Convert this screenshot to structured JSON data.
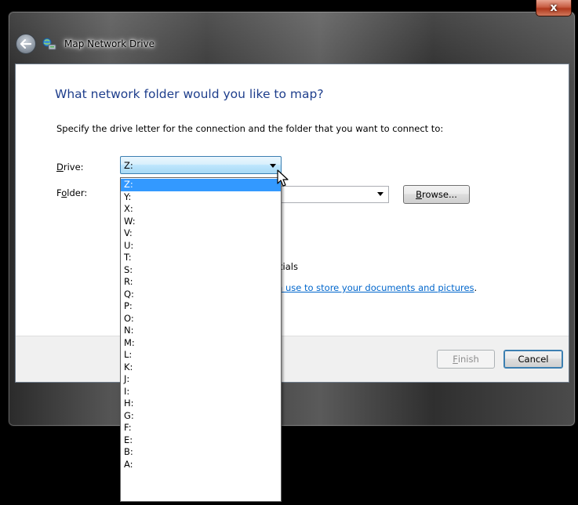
{
  "window": {
    "title": "Map Network Drive",
    "close_glyph": "x"
  },
  "main": {
    "heading": "What network folder would you like to map?",
    "instruction": "Specify the drive letter for the connection and the folder that you want to connect to:",
    "drive_label_accel": "D",
    "drive_label_rest": "rive:",
    "folder_label_pre": "F",
    "folder_label_accel": "o",
    "folder_label_rest": "lder:",
    "drive_value": "Z:",
    "folder_value": "",
    "browse_accel": "B",
    "browse_rest": "rowse...",
    "partial_checkbox_text": "tials",
    "partial_link_text": "n use to store your documents and pictures",
    "partial_link_suffix": "."
  },
  "footer": {
    "finish_accel": "F",
    "finish_rest": "inish",
    "cancel_label": "Cancel"
  },
  "dropdown": {
    "options": [
      "Z:",
      "Y:",
      "X:",
      "W:",
      "V:",
      "U:",
      "T:",
      "S:",
      "R:",
      "Q:",
      "P:",
      "O:",
      "N:",
      "M:",
      "L:",
      "K:",
      "J:",
      "I:",
      "H:",
      "G:",
      "F:",
      "E:",
      "B:",
      "A:"
    ],
    "selected": "Z:"
  },
  "colors": {
    "heading": "#1e3e8c",
    "link": "#0066cc",
    "selection": "#3399ff",
    "close_button": "#c75d43"
  },
  "icons": {
    "back": "back-arrow-icon",
    "title": "network-drive-icon",
    "close": "close-icon",
    "dropdown_arrow": "chevron-down-icon",
    "cursor": "mouse-pointer-icon"
  }
}
